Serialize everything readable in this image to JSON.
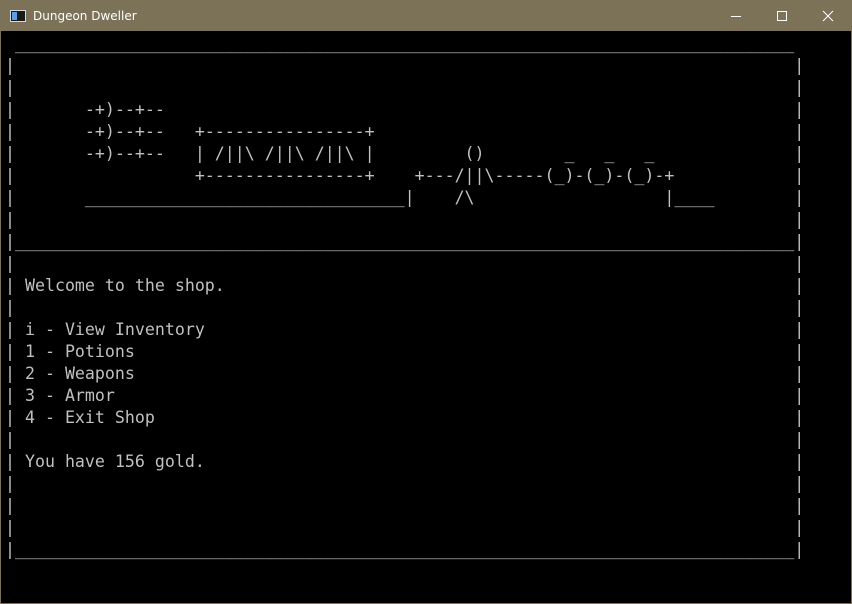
{
  "window": {
    "title": "Dungeon Dweller",
    "controls": {
      "minimize": "minimize",
      "maximize": "maximize",
      "close": "close"
    }
  },
  "console": {
    "banner_lines": [
      " ______________________________________________________________________________",
      "|                                                                              |",
      "|                                                                              |",
      "|       -+)--+--                                                               |",
      "|       -+)--+--   +----------------+                                          |",
      "|       -+)--+--   | /||\\ /||\\ /||\\ |         ()        _   _   _              |",
      "|                  +----------------+    +---/||\\-----(_)-(_)-(_)-+            |",
      "|       ________________________________|    /\\                   |____        |",
      "|                                                                              |",
      "|______________________________________________________________________________|"
    ],
    "body_lines": [
      "|                                                                              |",
      "| Welcome to the shop.                                                         |",
      "|                                                                              |",
      "| i - View Inventory                                                           |",
      "| 1 - Potions                                                                  |",
      "| 2 - Weapons                                                                  |",
      "| 3 - Armor                                                                    |",
      "| 4 - Exit Shop                                                                |",
      "|                                                                              |",
      "| You have 156 gold.                                                           |",
      "|                                                                              |",
      "|                                                                              |",
      "|                                                                              |",
      "|______________________________________________________________________________|"
    ]
  },
  "colors": {
    "titlebar": "#7b7258",
    "console_bg": "#000000",
    "console_text": "#c0c0c0"
  }
}
